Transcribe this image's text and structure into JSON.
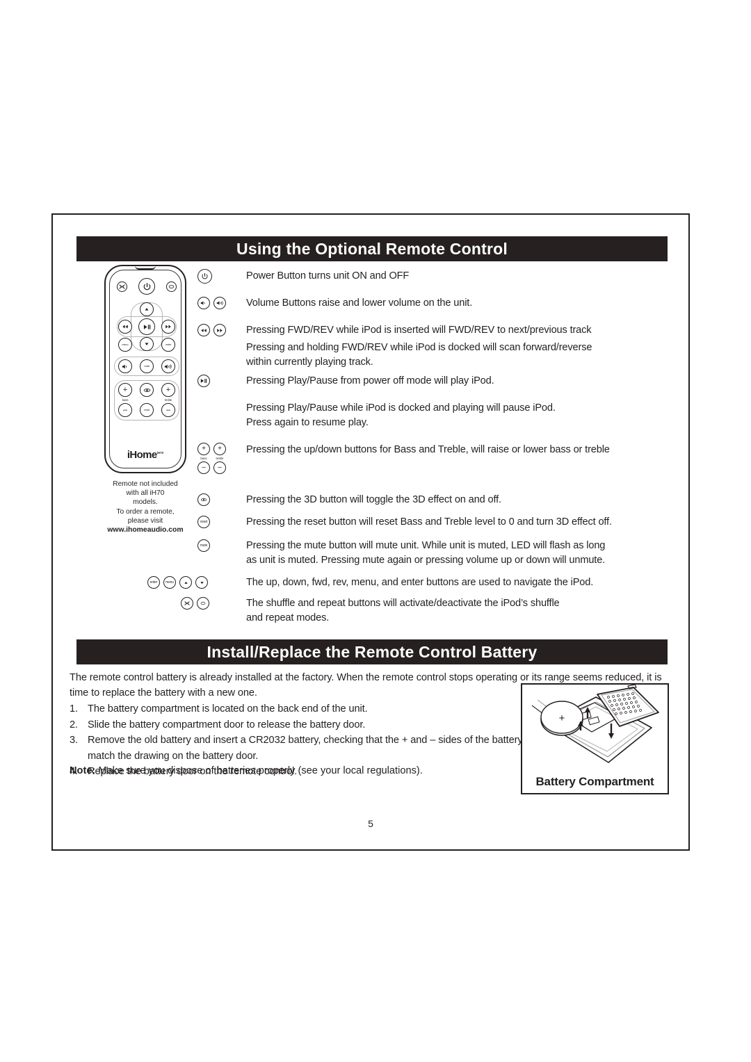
{
  "page": {
    "number": "5"
  },
  "sections": {
    "remote": {
      "title": "Using the Optional Remote Control"
    },
    "battery": {
      "title": "Install/Replace the Remote Control Battery"
    }
  },
  "remote_figure": {
    "brand": "iHome",
    "brand_sup": "iH70",
    "note_lines": [
      "Remote not included",
      "with all iH70",
      "models.",
      "To order a remote,",
      "please visit"
    ],
    "website": "www.ihomeaudio.com",
    "keys": {
      "shuffle": "shuffle-icon",
      "power": "power-icon",
      "repeat": "repeat-icon",
      "up": "up-arrow-icon",
      "rev": "rewind-icon",
      "play_pause": "play-pause-icon",
      "fwd": "fast-forward-icon",
      "menu": "menu",
      "down": "down-arrow-icon",
      "enter": "enter",
      "vol_down": "volume-down-icon",
      "mute": "mute",
      "vol_up": "volume-up-icon",
      "bass_up": "+",
      "three_d": "3D",
      "treble_up": "+",
      "bass_label": "bass",
      "treble_label": "treble",
      "bass_down": "–",
      "reset": "reset",
      "treble_down": "–"
    }
  },
  "instructions": [
    {
      "id": "power",
      "icons": [
        "power-icon"
      ],
      "text": "Power Button turns unit ON and OFF"
    },
    {
      "id": "volume",
      "icons": [
        "volume-down-icon",
        "volume-up-icon"
      ],
      "text": "Volume Buttons raise and lower volume on the unit."
    },
    {
      "id": "fwd-rev",
      "icons": [
        "rewind-icon",
        "fast-forward-icon"
      ],
      "text": "Pressing FWD/REV while iPod is inserted will FWD/REV to next/previous track"
    },
    {
      "id": "fwd-rev-hold",
      "icons": [],
      "text": " Pressing and holding FWD/REV while iPod is  docked will scan forward/reverse\n within currently playing track."
    },
    {
      "id": "play-pause",
      "icons": [
        "play-pause-icon"
      ],
      "text": "Pressing Play/Pause from power off mode will play iPod."
    },
    {
      "id": "play-pause-docked",
      "icons": [],
      "text": "Pressing Play/Pause while iPod is docked and playing will pause iPod.\nPress again to resume play."
    },
    {
      "id": "bass-treble",
      "icons": [
        "bass-stepper-icon",
        "treble-stepper-icon"
      ],
      "text": "Pressing the up/down buttons for Bass and Treble, will raise or lower bass or treble"
    },
    {
      "id": "three-d",
      "icons": [
        "three-d-icon"
      ],
      "text": "Pressing the 3D button will toggle the 3D effect on  and off."
    },
    {
      "id": "reset",
      "icons": [
        "reset-icon"
      ],
      "text": "Pressing the reset button will reset Bass and Treble level to 0 and turn 3D effect off."
    },
    {
      "id": "mute",
      "icons": [
        "mute-icon"
      ],
      "text": "Pressing the mute button will mute unit. While unit is muted, LED will flash as long\nas unit is muted. Pressing mute again or pressing volume up or down will unmute."
    },
    {
      "id": "navigate",
      "icons": [
        "enter-icon",
        "menu-icon",
        "up-arrow-icon",
        "down-arrow-icon"
      ],
      "text": "The up, down, fwd, rev, menu, and enter buttons are used to navigate the iPod."
    },
    {
      "id": "shuffle-repeat",
      "icons": [
        "shuffle-icon",
        "repeat-icon"
      ],
      "text": "The shuffle and  repeat buttons will activate/deactivate the iPod’s shuffle\nand repeat modes."
    }
  ],
  "battery": {
    "intro": "The remote control battery is already installed at the factory. When the remote control stops operating or its range seems reduced, it is time to replace the battery with a new one.",
    "steps": [
      {
        "num": "1.",
        "text": "The battery compartment is located on the back end of the unit."
      },
      {
        "num": "2.",
        "text": "Slide the battery compartment door to release the battery door."
      },
      {
        "num": "3.",
        "text": "Remove the old battery and insert a CR2032 battery, checking that the + and – sides of the battery match the drawing on the battery door."
      },
      {
        "num": "4.",
        "text": "Replace the battery door on the remote control."
      }
    ],
    "note_label": "Note:",
    "note_text": " Make sure you dispose of batteries properly (see your local regulations).",
    "figure_caption": "Battery Compartment",
    "figure_battery_polarity": "+"
  }
}
